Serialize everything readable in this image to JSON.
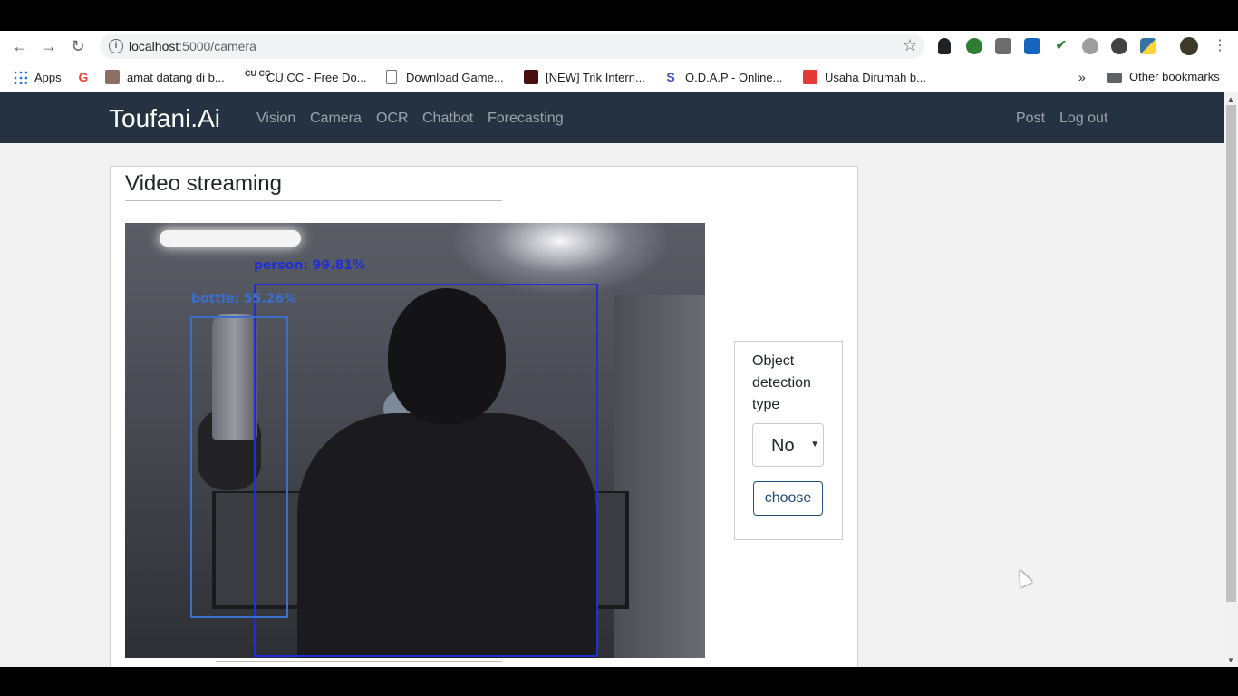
{
  "browser": {
    "url_host": "localhost",
    "url_path": ":5000/camera"
  },
  "bookmarks": [
    {
      "label": "Apps",
      "icon": "apps-grid-icon",
      "color": "#1a73e8"
    },
    {
      "label": "",
      "icon": "google-icon",
      "color": "#ea4335"
    },
    {
      "label": "amat datang di b...",
      "icon": "site-icon",
      "color": "#8d6e63"
    },
    {
      "label": "CU.CC - Free Do...",
      "icon": "cucc-icon",
      "color": "#333333"
    },
    {
      "label": "Download Game...",
      "icon": "page-icon",
      "color": "#9e9e9e"
    },
    {
      "label": "[NEW] Trik Intern...",
      "icon": "sn-icon",
      "color": "#4a1010"
    },
    {
      "label": "O.D.A.P - Online...",
      "icon": "odap-icon",
      "color": "#3f51b5"
    },
    {
      "label": "Usaha Dirumah b...",
      "icon": "blogger-icon",
      "color": "#e53935"
    }
  ],
  "other_bookmarks": "Other bookmarks",
  "navbar": {
    "brand": "Toufani.Ai",
    "links": [
      "Vision",
      "Camera",
      "OCR",
      "Chatbot",
      "Forecasting"
    ],
    "right_links": [
      "Post",
      "Log out"
    ]
  },
  "main": {
    "title": "Video streaming",
    "detections": [
      {
        "label": "person:  99.81%",
        "color": "#1f2ed6"
      },
      {
        "label": "bottle:  55.26%",
        "color": "#3a6fd0"
      }
    ]
  },
  "panel": {
    "label": "Object detection type",
    "select_value": "No",
    "button": "choose"
  }
}
